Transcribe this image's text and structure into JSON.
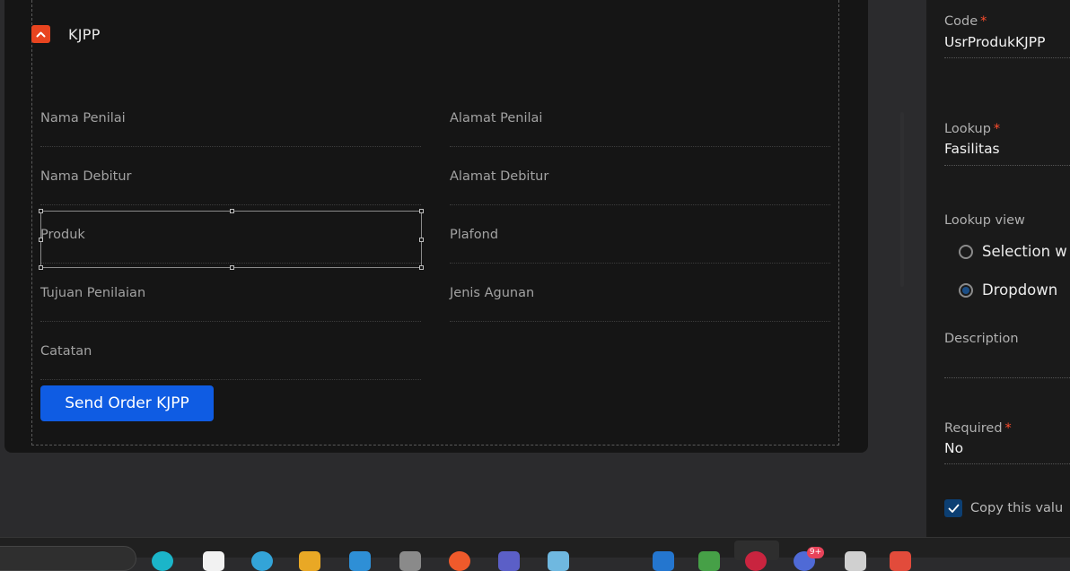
{
  "group": {
    "title": "KJPP"
  },
  "fields": {
    "nama_penilai": "Nama Penilai",
    "alamat_penilai": "Alamat Penilai",
    "nama_debitur": "Nama Debitur",
    "alamat_debitur": "Alamat Debitur",
    "produk": "Produk",
    "plafond": "Plafond",
    "tujuan_penilaian": "Tujuan Penilaian",
    "jenis_agunan": "Jenis Agunan",
    "catatan": "Catatan"
  },
  "actions": {
    "send_order": "Send Order KJPP"
  },
  "properties": {
    "code_label": "Code",
    "code_value": "UsrProdukKJPP",
    "lookup_label": "Lookup",
    "lookup_value": "Fasilitas",
    "lookup_view_label": "Lookup view",
    "lookup_view_options": [
      "Selection w",
      "Dropdown"
    ],
    "lookup_view_selected": "Dropdown",
    "description_label": "Description",
    "description_value": "",
    "required_label": "Required",
    "required_value": "No",
    "copy_value_label": "Copy this valu",
    "copy_value_checked": true,
    "required_marker": "*"
  },
  "taskbar": {
    "badge": "9+"
  },
  "colors": {
    "accent_orange": "#e8441f",
    "primary_blue": "#0f5ce3",
    "required_red": "#ff4d2d",
    "checkbox_blue": "#0c3f73"
  }
}
